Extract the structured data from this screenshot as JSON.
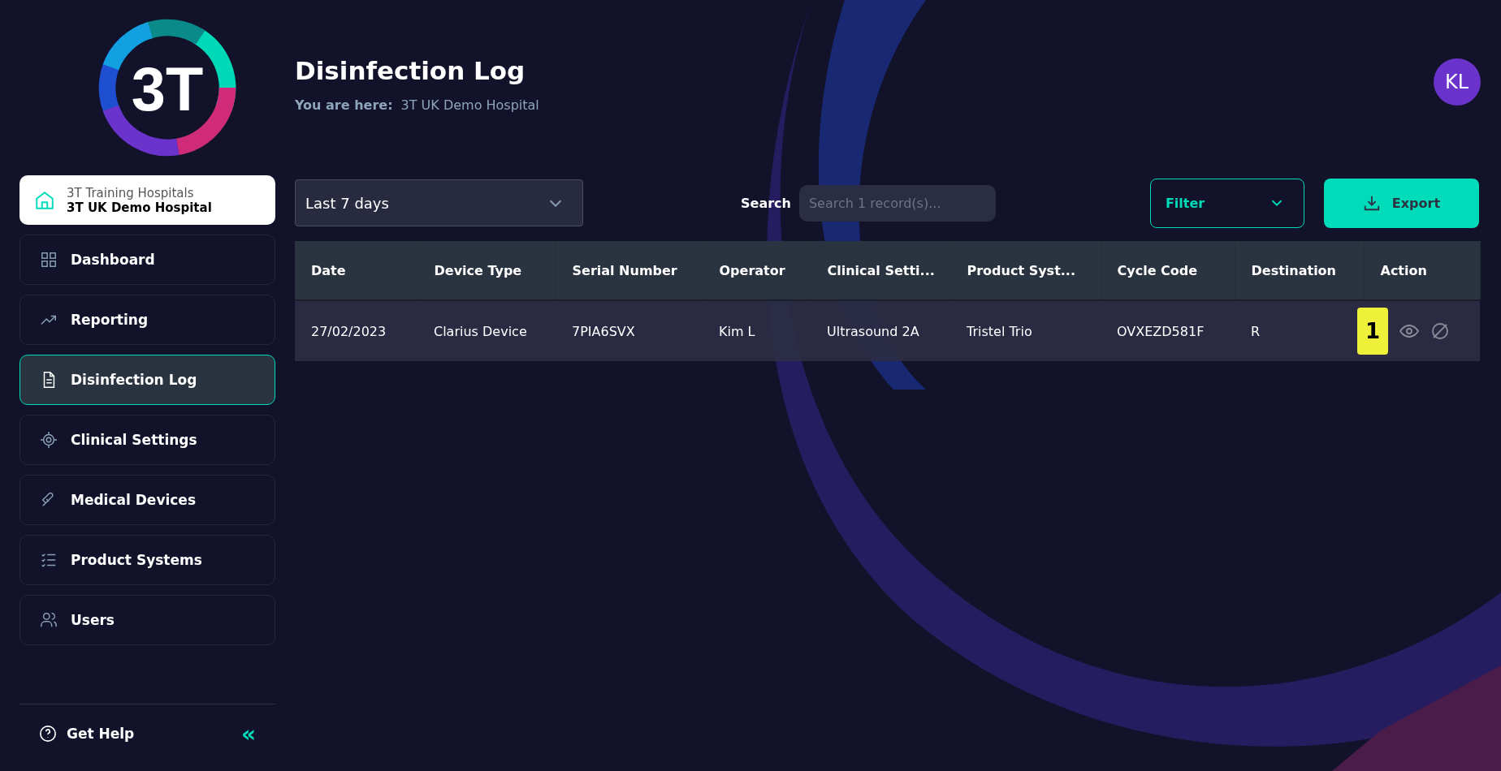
{
  "logo": {
    "text": "3T"
  },
  "hospital": {
    "group": "3T Training Hospitals",
    "name": "3T UK Demo Hospital"
  },
  "nav": [
    {
      "label": "Dashboard",
      "kind": "grid",
      "selected": false
    },
    {
      "label": "Reporting",
      "kind": "trend",
      "selected": false
    },
    {
      "label": "Disinfection Log",
      "kind": "document",
      "selected": true
    },
    {
      "label": "Clinical Settings",
      "kind": "target",
      "selected": false
    },
    {
      "label": "Medical Devices",
      "kind": "probe",
      "selected": false
    },
    {
      "label": "Product Systems",
      "kind": "checklist",
      "selected": false
    },
    {
      "label": "Users",
      "kind": "users",
      "selected": false
    }
  ],
  "help": {
    "label": "Get Help",
    "collapse": "«"
  },
  "header": {
    "title": "Disinfection Log",
    "breadcrumb_label": "You are here:",
    "breadcrumb": "3T UK Demo Hospital",
    "avatar": "KL"
  },
  "toolbar": {
    "period": "Last 7 days",
    "search_label": "Search",
    "search_placeholder": "Search 1 record(s)...",
    "filter": "Filter",
    "export": "Export"
  },
  "table": {
    "columns": [
      "Date",
      "Device Type",
      "Serial Number",
      "Operator",
      "Clinical Setti...",
      "Product Syst...",
      "Cycle Code",
      "Destination",
      "Action"
    ],
    "rows": [
      {
        "cells": [
          "27/02/2023",
          "Clarius Device",
          "7PIA6SVX",
          "Kim L",
          "Ultrasound 2A",
          "Tristel Trio",
          "OVXEZD581F",
          "R"
        ],
        "badge": "1"
      }
    ]
  }
}
